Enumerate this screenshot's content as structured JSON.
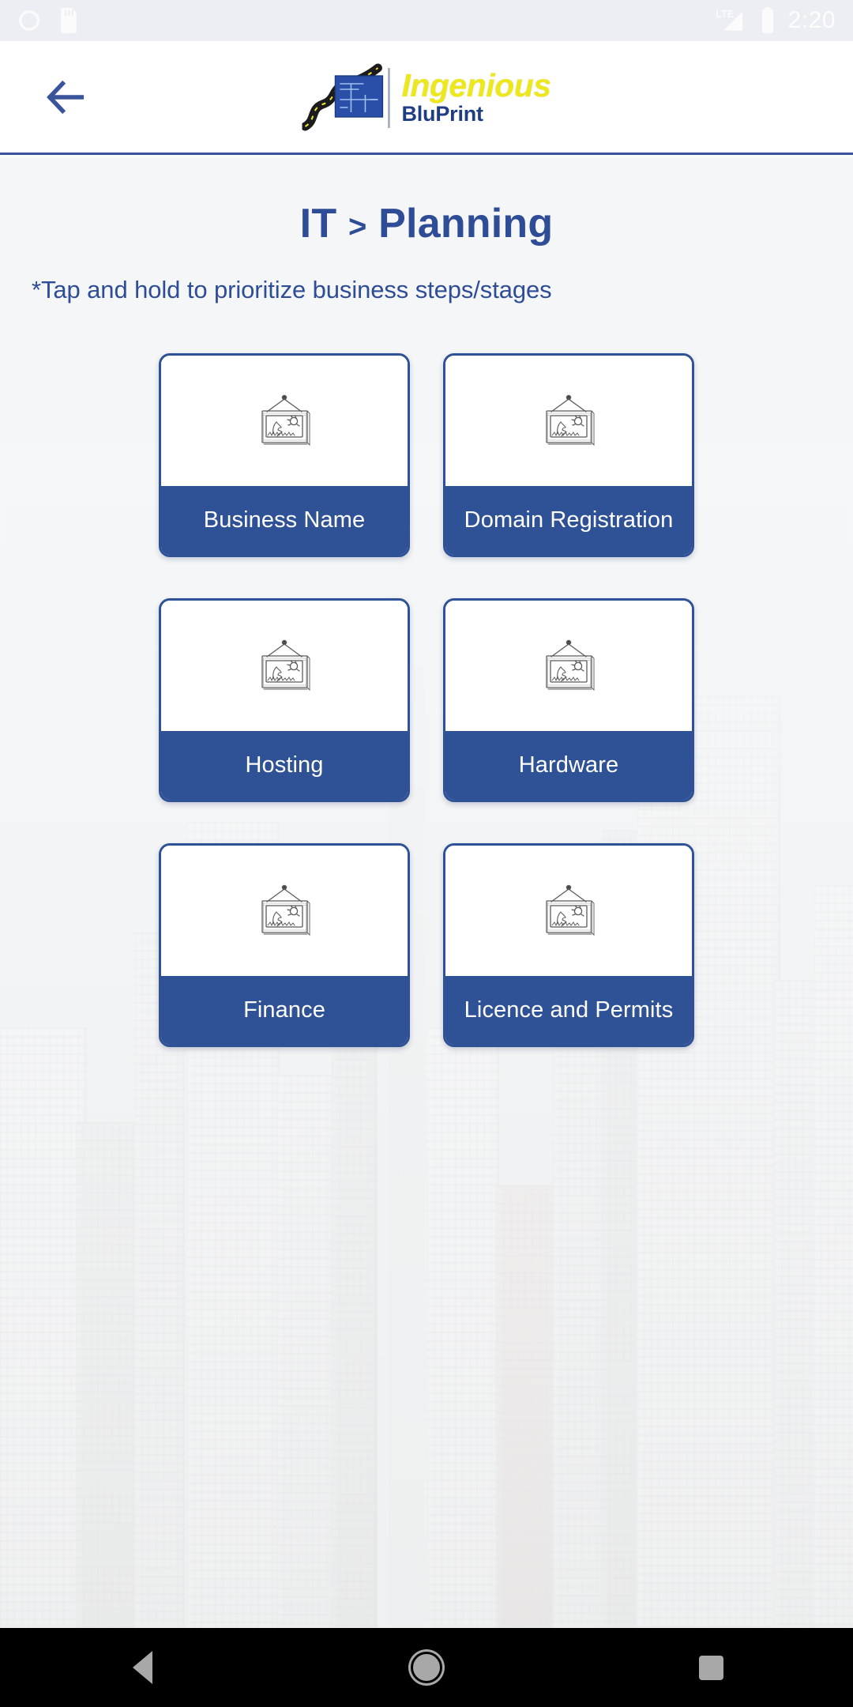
{
  "status_bar": {
    "time": "2:20",
    "network_label": "LTE",
    "icons": [
      "circle-notification-icon",
      "sd-card-icon",
      "lte-signal-icon",
      "battery-icon"
    ]
  },
  "header": {
    "back_label": "back-arrow",
    "logo": {
      "word_primary": "Ingenious",
      "word_secondary": "BluPrint",
      "mark": "blueprint-road-logo-icon"
    }
  },
  "page": {
    "title_prefix": "IT",
    "title_separator": ">",
    "title_suffix": "Planning",
    "hint": "*Tap and hold to prioritize business steps/stages"
  },
  "cards": [
    {
      "label": "Business Name",
      "thumb": "broken-image-placeholder-icon"
    },
    {
      "label": "Domain Registration",
      "thumb": "broken-image-placeholder-icon"
    },
    {
      "label": "Hosting",
      "thumb": "broken-image-placeholder-icon"
    },
    {
      "label": "Hardware",
      "thumb": "broken-image-placeholder-icon"
    },
    {
      "label": "Finance",
      "thumb": "broken-image-placeholder-icon"
    },
    {
      "label": "Licence and Permits",
      "thumb": "broken-image-placeholder-icon"
    }
  ],
  "nav_bar": {
    "back": "android-back-button",
    "home": "android-home-button",
    "recents": "android-recents-button"
  },
  "colors": {
    "brand_blue": "#2f5196",
    "title_blue": "#2f4d96",
    "logo_yellow": "#ece81d",
    "status_bar_bg": "#eceef3",
    "nav_bar_bg": "#000000",
    "card_bg": "#ffffff"
  }
}
